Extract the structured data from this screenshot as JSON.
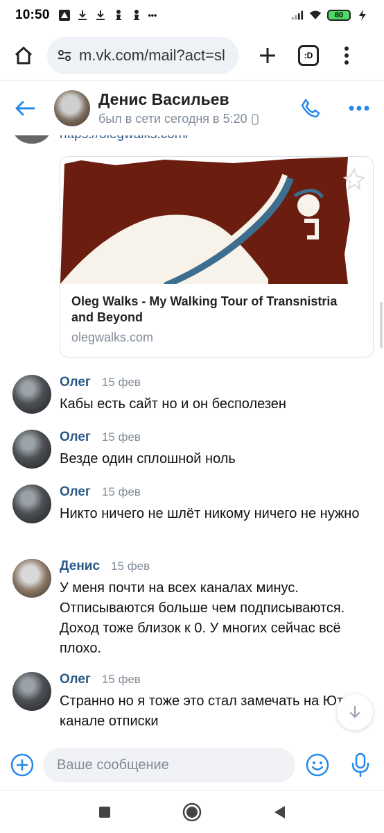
{
  "status_bar": {
    "time": "10:50",
    "left_icons": [
      "app-icon",
      "download-icon",
      "download-icon",
      "chess-icon",
      "chess-icon",
      "more-dots"
    ],
    "dots": "•••",
    "battery": "80"
  },
  "browser": {
    "url": "m.vk.com/mail?act=sl",
    "tabs_label": ":D"
  },
  "chat_header": {
    "name": "Денис Васильев",
    "status": "был в сети сегодня в 5:20"
  },
  "link_preview": {
    "cut_link": "https://olegwalks.com/",
    "title": "Oleg Walks - My Walking Tour of Transnistria and Beyond",
    "domain": "olegwalks.com"
  },
  "messages": [
    {
      "author": "Олег",
      "date": "15 фев",
      "text": "Кабы есть сайт но и он бесполезен"
    },
    {
      "author": "Олег",
      "date": "15 фев",
      "text": "Везде один сплошной ноль"
    },
    {
      "author": "Олег",
      "date": "15 фев",
      "text": "Никто ничего не шлёт никому ничего не нужно"
    },
    {
      "author": "Денис",
      "date": "15 фев",
      "text": "У меня почти на всех каналах минус. Отписываются больше чем подписываются. Доход тоже близок к 0. У многих сейчас всё плохо."
    },
    {
      "author": "Олег",
      "date": "15 фев",
      "text": "Странно но я тоже это стал замечать на Ютуб канале отписки"
    }
  ],
  "composer": {
    "placeholder": "Ваше сообщение"
  },
  "colors": {
    "vk_blue": "#2a5885",
    "accent_blue": "#2688eb",
    "secondary_text": "#818c99",
    "card_bg": "#6b1d0f"
  }
}
